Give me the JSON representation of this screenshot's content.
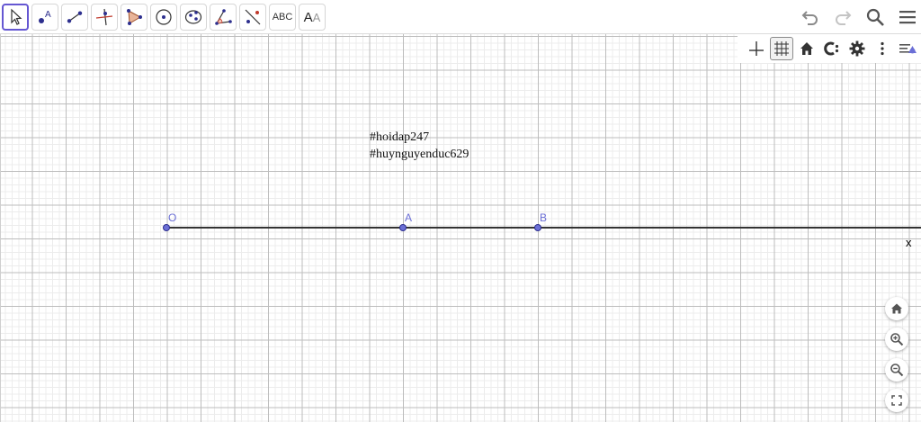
{
  "toolbar": {
    "tools": [
      {
        "name": "move-tool-icon",
        "active": true
      },
      {
        "name": "point-tool-icon"
      },
      {
        "name": "segment-tool-icon"
      },
      {
        "name": "perpendicular-line-tool-icon"
      },
      {
        "name": "polygon-tool-icon"
      },
      {
        "name": "circle-center-point-tool-icon"
      },
      {
        "name": "ellipse-tool-icon"
      },
      {
        "name": "angle-tool-icon"
      },
      {
        "name": "reflect-tool-icon"
      },
      {
        "name": "text-tool",
        "label": "ABC"
      },
      {
        "name": "text-style-tool",
        "label_big": "A",
        "label_small": "A"
      }
    ],
    "right": [
      "undo-icon",
      "redo-icon",
      "search-icon",
      "menu-icon"
    ]
  },
  "style_bar": [
    "axes-toggle-icon",
    "grid-toggle-icon",
    "home-view-icon",
    "point-capture-icon",
    "settings-gear-icon",
    "more-vert-icon",
    "style-bar-toggle-icon"
  ],
  "canvas": {
    "points": [
      {
        "label": "O"
      },
      {
        "label": "A"
      },
      {
        "label": "B"
      }
    ],
    "axis_label": "x",
    "text_lines": [
      "#hoidap247",
      "#huynguyenduc629"
    ],
    "colors": {
      "point_fill": "#6b6fd6",
      "point_stroke": "#2d2f8e",
      "ray": "#333333"
    }
  },
  "zoom_controls": [
    "home-icon",
    "zoom-in-icon",
    "zoom-out-icon",
    "fullscreen-icon"
  ]
}
